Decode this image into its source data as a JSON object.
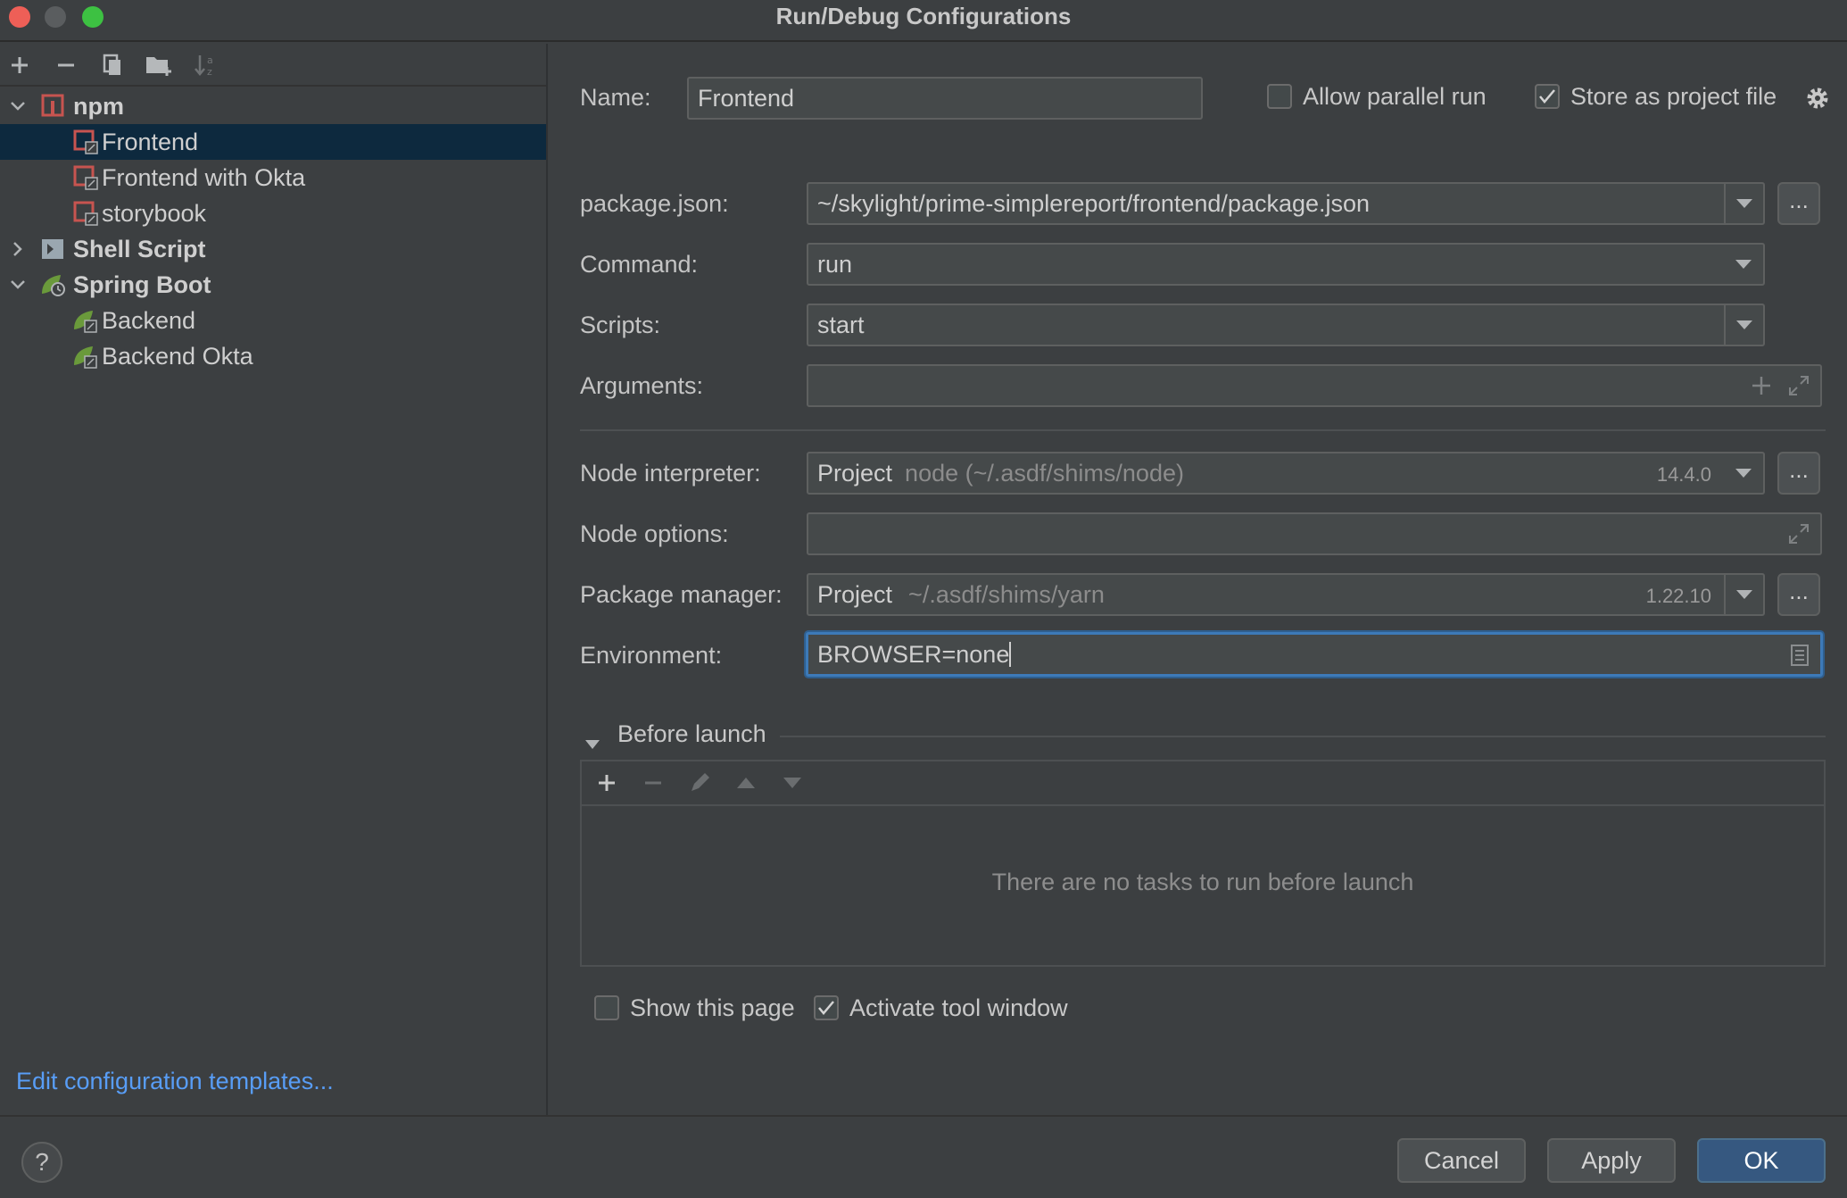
{
  "window": {
    "title": "Run/Debug Configurations"
  },
  "left_toolbar": {
    "icons": [
      "add-icon",
      "remove-icon",
      "copy-icon",
      "new-folder-icon",
      "sort-icon"
    ]
  },
  "tree": {
    "npm": {
      "label": "npm",
      "children": [
        "Frontend",
        "Frontend with Okta",
        "storybook"
      ]
    },
    "shell": {
      "label": "Shell Script"
    },
    "spring": {
      "label": "Spring Boot",
      "children": [
        "Backend",
        "Backend Okta"
      ]
    },
    "selected": "Frontend"
  },
  "edit_templates_link": "Edit configuration templates...",
  "form": {
    "name_label": "Name:",
    "name_value": "Frontend",
    "allow_parallel": {
      "label": "Allow parallel run",
      "checked": false
    },
    "store_project": {
      "label": "Store as project file",
      "checked": true
    },
    "package_json_label": "package.json:",
    "package_json_value": "~/skylight/prime-simplereport/frontend/package.json",
    "command_label": "Command:",
    "command_value": "run",
    "scripts_label": "Scripts:",
    "scripts_value": "start",
    "arguments_label": "Arguments:",
    "arguments_value": "",
    "node_interpreter_label": "Node interpreter:",
    "node_interpreter_kind": "Project",
    "node_interpreter_path": "node (~/.asdf/shims/node)",
    "node_interpreter_version": "14.4.0",
    "node_options_label": "Node options:",
    "node_options_value": "",
    "package_manager_label": "Package manager:",
    "package_manager_kind": "Project",
    "package_manager_path": "~/.asdf/shims/yarn",
    "package_manager_version": "1.22.10",
    "environment_label": "Environment:",
    "environment_value": "BROWSER=none",
    "ellipsis": "..."
  },
  "before_launch": {
    "title": "Before launch",
    "empty_text": "There are no tasks to run before launch"
  },
  "options": {
    "show_page": {
      "label": "Show this page",
      "checked": false
    },
    "activate_tool": {
      "label": "Activate tool window",
      "checked": true
    }
  },
  "buttons": {
    "cancel": "Cancel",
    "apply": "Apply",
    "ok": "OK",
    "help": "?"
  },
  "colors": {
    "accent": "#365880",
    "link": "#589df6",
    "selection": "#0d293e",
    "npm_red": "#c75450",
    "spring_green": "#6a9a3b"
  }
}
